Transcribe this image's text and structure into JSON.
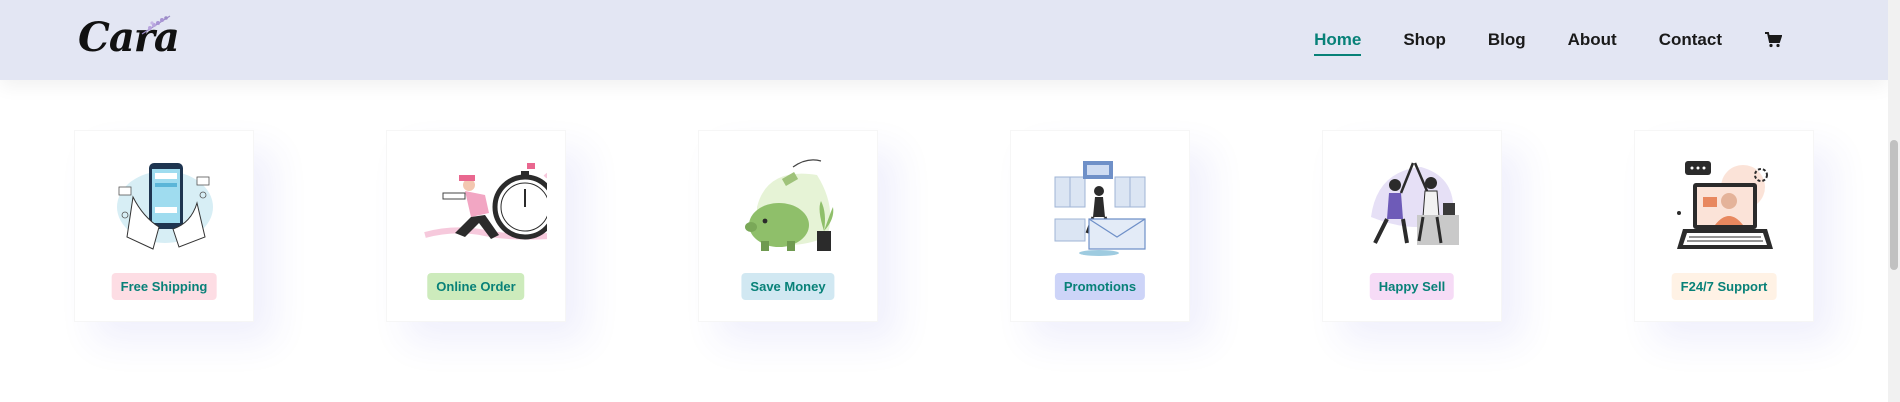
{
  "brand": {
    "name": "Cara"
  },
  "nav": {
    "items": [
      {
        "label": "Home",
        "active": true
      },
      {
        "label": "Shop"
      },
      {
        "label": "Blog"
      },
      {
        "label": "About"
      },
      {
        "label": "Contact"
      }
    ],
    "cart_icon": "shopping-cart-icon"
  },
  "features": [
    {
      "label": "Free Shipping",
      "color": "#fddde4",
      "illustration": "phone-payment"
    },
    {
      "label": "Online Order",
      "color": "#cdebbc",
      "illustration": "stopwatch-runner"
    },
    {
      "label": "Save Money",
      "color": "#d1e8f2",
      "illustration": "piggy-bank"
    },
    {
      "label": "Promotions",
      "color": "#cdd4f8",
      "illustration": "envelope-celebration"
    },
    {
      "label": "Happy Sell",
      "color": "#f6dbf6",
      "illustration": "high-five"
    },
    {
      "label": "F24/7 Support",
      "color": "#fff2e5",
      "illustration": "laptop-support"
    }
  ],
  "colors": {
    "header_bg": "#e3e6f3",
    "accent": "#088178"
  }
}
